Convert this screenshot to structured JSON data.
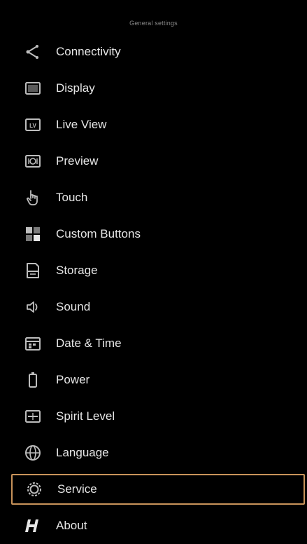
{
  "header": {
    "title": "General settings"
  },
  "menu": {
    "items": [
      {
        "label": "Connectivity",
        "icon": "share-icon"
      },
      {
        "label": "Display",
        "icon": "display-icon"
      },
      {
        "label": "Live View",
        "icon": "live-view-icon"
      },
      {
        "label": "Preview",
        "icon": "preview-icon"
      },
      {
        "label": "Touch",
        "icon": "touch-hand-icon"
      },
      {
        "label": "Custom Buttons",
        "icon": "custom-buttons-icon"
      },
      {
        "label": "Storage",
        "icon": "storage-icon"
      },
      {
        "label": "Sound",
        "icon": "speaker-icon"
      },
      {
        "label": "Date & Time",
        "icon": "calendar-icon"
      },
      {
        "label": "Power",
        "icon": "battery-icon"
      },
      {
        "label": "Spirit Level",
        "icon": "spirit-level-icon"
      },
      {
        "label": "Language",
        "icon": "globe-icon"
      },
      {
        "label": "Service",
        "icon": "gear-icon",
        "selected": true
      },
      {
        "label": "About",
        "icon": "brand-h-icon"
      }
    ]
  },
  "colors": {
    "background": "#000000",
    "text": "#e6e6e6",
    "header_text": "#8a8a8a",
    "selection_border": "#c8935a",
    "icon": "#bdbdbd"
  }
}
